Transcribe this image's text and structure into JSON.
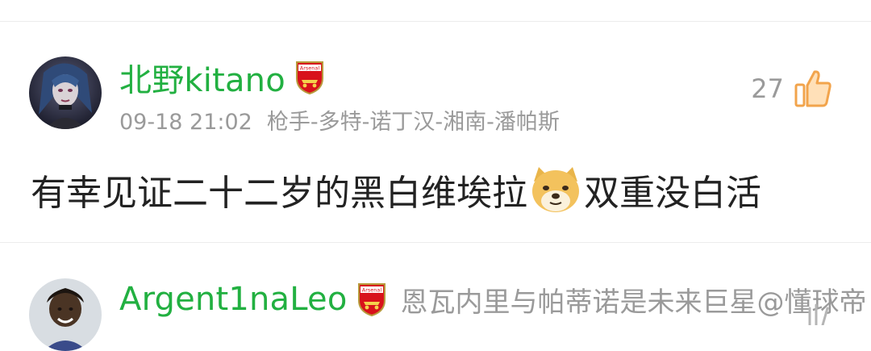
{
  "comments": [
    {
      "username": "北野kitano",
      "badge_icon": "arsenal-badge-icon",
      "badge_text": "Arsenal",
      "timestamp": "09-18 21:02",
      "team_path": "枪手-多特-诺丁汉-湘南-潘帕斯",
      "likes": "27",
      "text_part1": "有幸见证二十二岁的黑白维埃拉",
      "emoji": "doge-emoji",
      "text_part2": "双重没白活"
    },
    {
      "username": "Argent1naLeo",
      "badge_icon": "arsenal-badge-icon",
      "badge_text": "Arsenal",
      "reply_preview": "恩瓦内里与帕蒂诺是未来巨星@懂球帝"
    }
  ],
  "colors": {
    "username_green": "#22b041",
    "meta_gray": "#9a9a9a",
    "like_orange": "#f2a44c",
    "arsenal_red": "#d8121b"
  }
}
